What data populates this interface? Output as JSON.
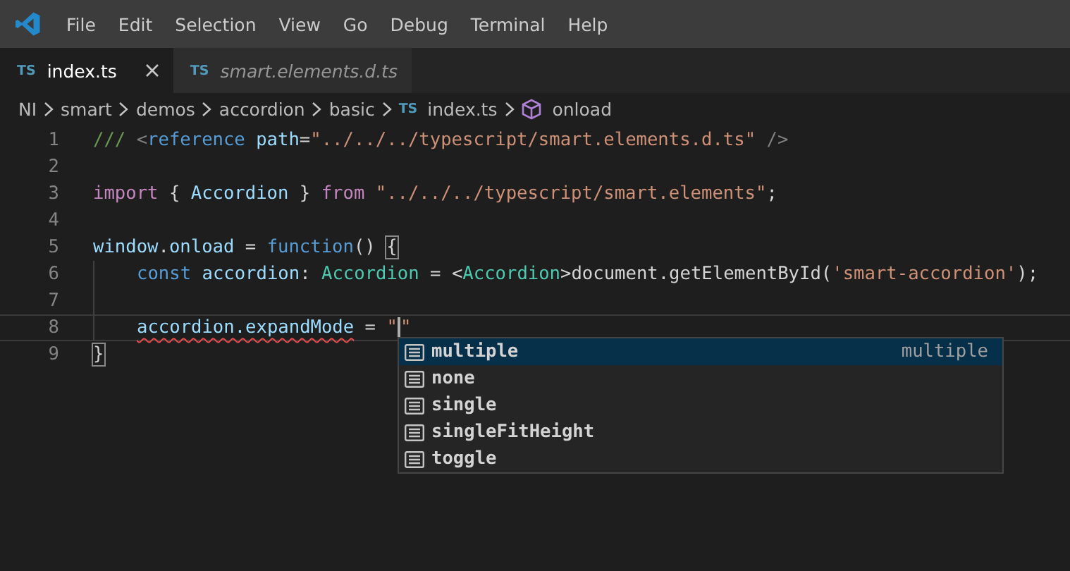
{
  "menu": [
    "File",
    "Edit",
    "Selection",
    "View",
    "Go",
    "Debug",
    "Terminal",
    "Help"
  ],
  "tabs": [
    {
      "label": "index.ts",
      "badge": "TS",
      "selected": true,
      "preview": false
    },
    {
      "label": "smart.elements.d.ts",
      "badge": "TS",
      "selected": false,
      "preview": true
    }
  ],
  "breadcrumbs": [
    {
      "kind": "folder",
      "label": "NI"
    },
    {
      "kind": "folder",
      "label": "smart"
    },
    {
      "kind": "folder",
      "label": "demos"
    },
    {
      "kind": "folder",
      "label": "accordion"
    },
    {
      "kind": "folder",
      "label": "basic"
    },
    {
      "kind": "file",
      "badge": "TS",
      "label": "index.ts"
    },
    {
      "kind": "symbol",
      "label": "onload"
    }
  ],
  "lines": [
    {
      "number": "1",
      "current": false,
      "indent": false,
      "tokens": [
        {
          "kind": "comment",
          "text": "/// "
        },
        {
          "kind": "punct",
          "text": "<"
        },
        {
          "kind": "tag",
          "text": "reference"
        },
        {
          "kind": "attr",
          "text": " path"
        },
        {
          "kind": "plain",
          "text": "="
        },
        {
          "kind": "string",
          "text": "\"../../../typescript/smart.elements.d.ts\""
        },
        {
          "kind": "punct",
          "text": " />"
        }
      ]
    },
    {
      "number": "2",
      "current": false,
      "indent": false
    },
    {
      "number": "3",
      "current": false,
      "indent": false,
      "tokens": [
        {
          "kind": "keyword",
          "text": "import"
        },
        {
          "kind": "plain",
          "text": " { "
        },
        {
          "kind": "var",
          "text": "Accordion"
        },
        {
          "kind": "plain",
          "text": " } "
        },
        {
          "kind": "keyword",
          "text": "from"
        },
        {
          "kind": "string",
          "text": " \"../../../typescript/smart.elements\""
        },
        {
          "kind": "plain",
          "text": ";"
        }
      ]
    },
    {
      "number": "4",
      "current": false,
      "indent": false
    },
    {
      "number": "5",
      "current": false,
      "indent": false,
      "tokens": [
        {
          "kind": "var",
          "text": "window"
        },
        {
          "kind": "plain",
          "text": "."
        },
        {
          "kind": "var",
          "text": "onload"
        },
        {
          "kind": "plain",
          "text": " = "
        },
        {
          "kind": "storage",
          "text": "function"
        },
        {
          "kind": "plain",
          "text": "() "
        },
        {
          "kind": "bracket",
          "text": "{"
        }
      ]
    },
    {
      "number": "6",
      "current": false,
      "indent": true,
      "tokens": [
        {
          "kind": "storage",
          "text": "const"
        },
        {
          "kind": "var",
          "text": " accordion"
        },
        {
          "kind": "plain",
          "text": ": "
        },
        {
          "kind": "type",
          "text": "Accordion"
        },
        {
          "kind": "plain",
          "text": " = <"
        },
        {
          "kind": "type",
          "text": "Accordion"
        },
        {
          "kind": "plain",
          "text": ">document.getElementById("
        },
        {
          "kind": "string",
          "text": "'smart-accordion'"
        },
        {
          "kind": "plain",
          "text": ");"
        }
      ]
    },
    {
      "number": "7",
      "current": false,
      "indent": true
    },
    {
      "number": "8",
      "current": true,
      "indent": true,
      "tokens": [
        {
          "kind": "error",
          "text": "accordion.expandMode"
        },
        {
          "kind": "plain",
          "text": " = "
        },
        {
          "kind": "string",
          "text": "\""
        },
        {
          "kind": "caret"
        },
        {
          "kind": "string",
          "text": "\""
        }
      ]
    },
    {
      "number": "9",
      "current": false,
      "indent": false,
      "tokens": [
        {
          "kind": "bracket",
          "text": "}"
        }
      ]
    }
  ],
  "suggestions": [
    {
      "label": "multiple",
      "detail": "multiple",
      "selected": true
    },
    {
      "label": "none",
      "selected": false
    },
    {
      "label": "single",
      "selected": false
    },
    {
      "label": "singleFitHeight",
      "selected": false
    },
    {
      "label": "toggle",
      "selected": false
    }
  ]
}
